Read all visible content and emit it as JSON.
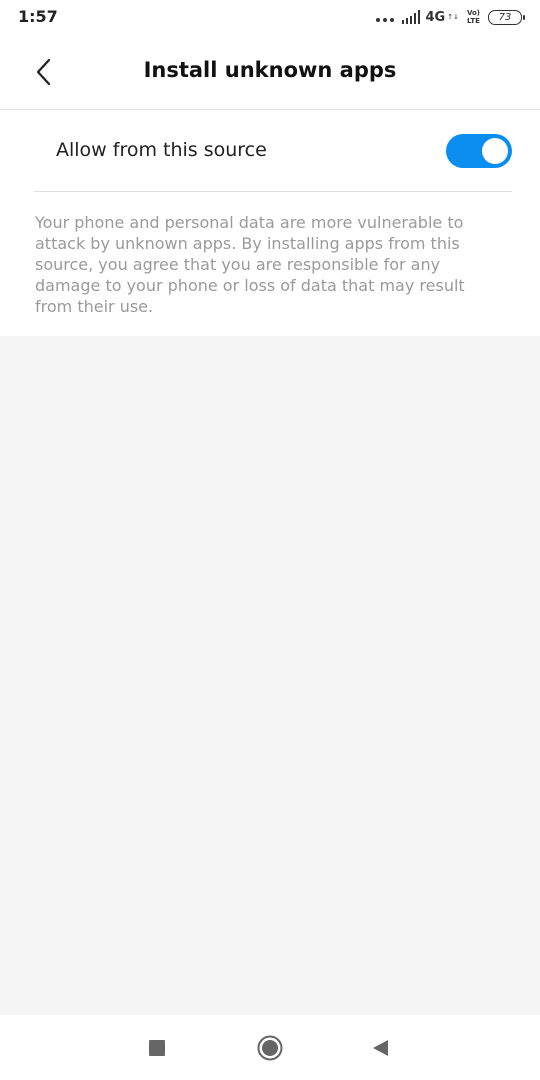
{
  "status_bar": {
    "time": "1:57",
    "network": "4G",
    "volte_top": "Vo)",
    "volte_bottom": "LTE",
    "battery": "73"
  },
  "header": {
    "title": "Install unknown apps",
    "back_icon": "chevron-left-icon"
  },
  "setting": {
    "label": "Allow from this source",
    "enabled": true,
    "accent": "#0a8ef0"
  },
  "warning": {
    "text": "Your phone and personal data are more vulnerable to attack by unknown apps. By installing apps from this source, you agree that you are responsible for any damage to your phone or loss of data that may result from their use."
  },
  "nav_bar": {
    "recents_icon": "square-icon",
    "home_icon": "circle-icon",
    "back_icon": "triangle-left-icon"
  }
}
